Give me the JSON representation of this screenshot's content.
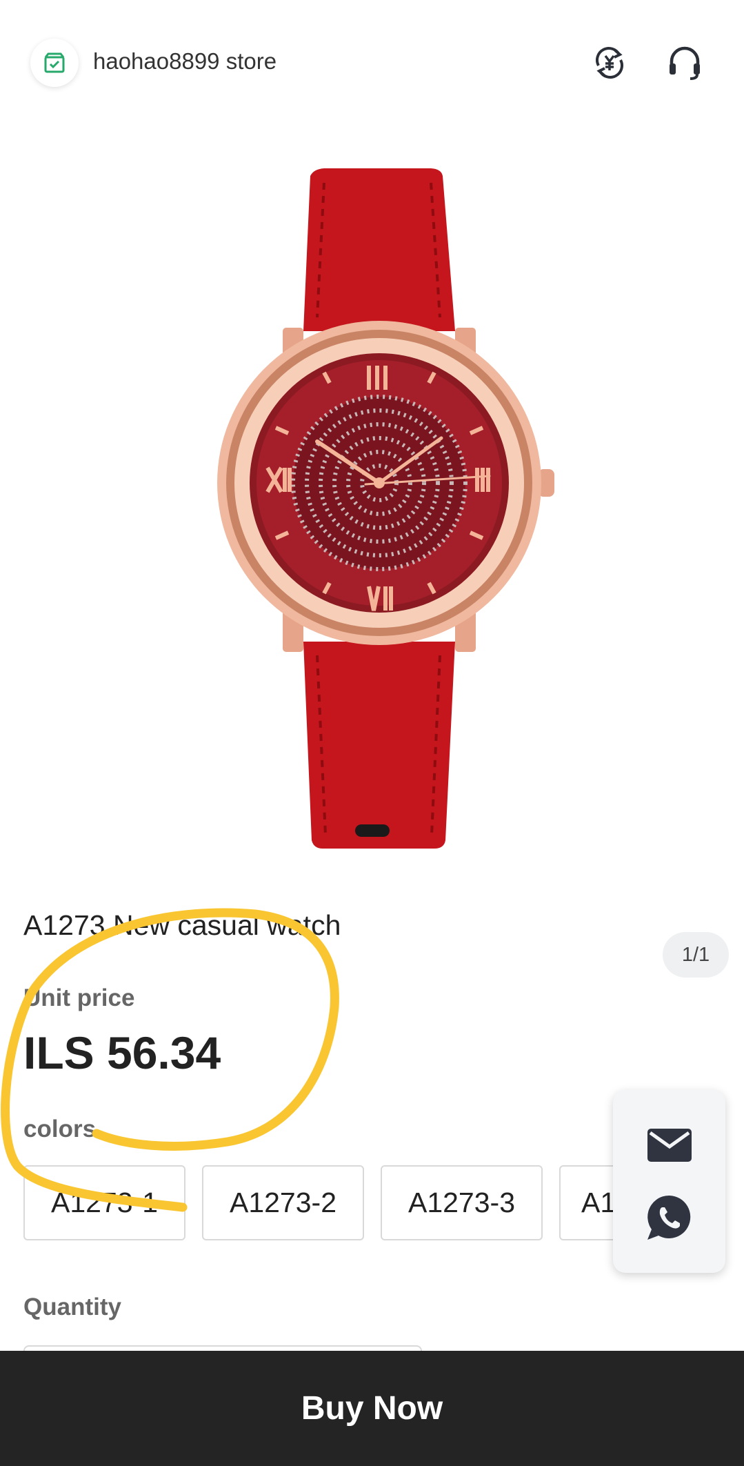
{
  "store": {
    "name": "haohao8899 store",
    "logo_icon": "store-check-icon",
    "accent": "#26a96b"
  },
  "header": {
    "currency_icon": "currency-exchange-icon",
    "support_icon": "headset-icon"
  },
  "gallery": {
    "counter": "1/1",
    "image": "red-leather-watch"
  },
  "product": {
    "title": "A1273 New casual watch",
    "unit_price_label": "Unit price",
    "price": "ILS 56.34",
    "colors_label": "colors",
    "options": [
      "A1273-1",
      "A1273-2",
      "A1273-3",
      "A1"
    ],
    "quantity_label": "Quantity"
  },
  "contact": {
    "mail_icon": "mail-icon",
    "whatsapp_icon": "whatsapp-icon"
  },
  "buy_button": "Buy Now",
  "colors": {
    "buy_bg": "#242424",
    "annotation": "#f9c631",
    "strap": "#c4161c",
    "rose_gold": "#e8a88c"
  }
}
